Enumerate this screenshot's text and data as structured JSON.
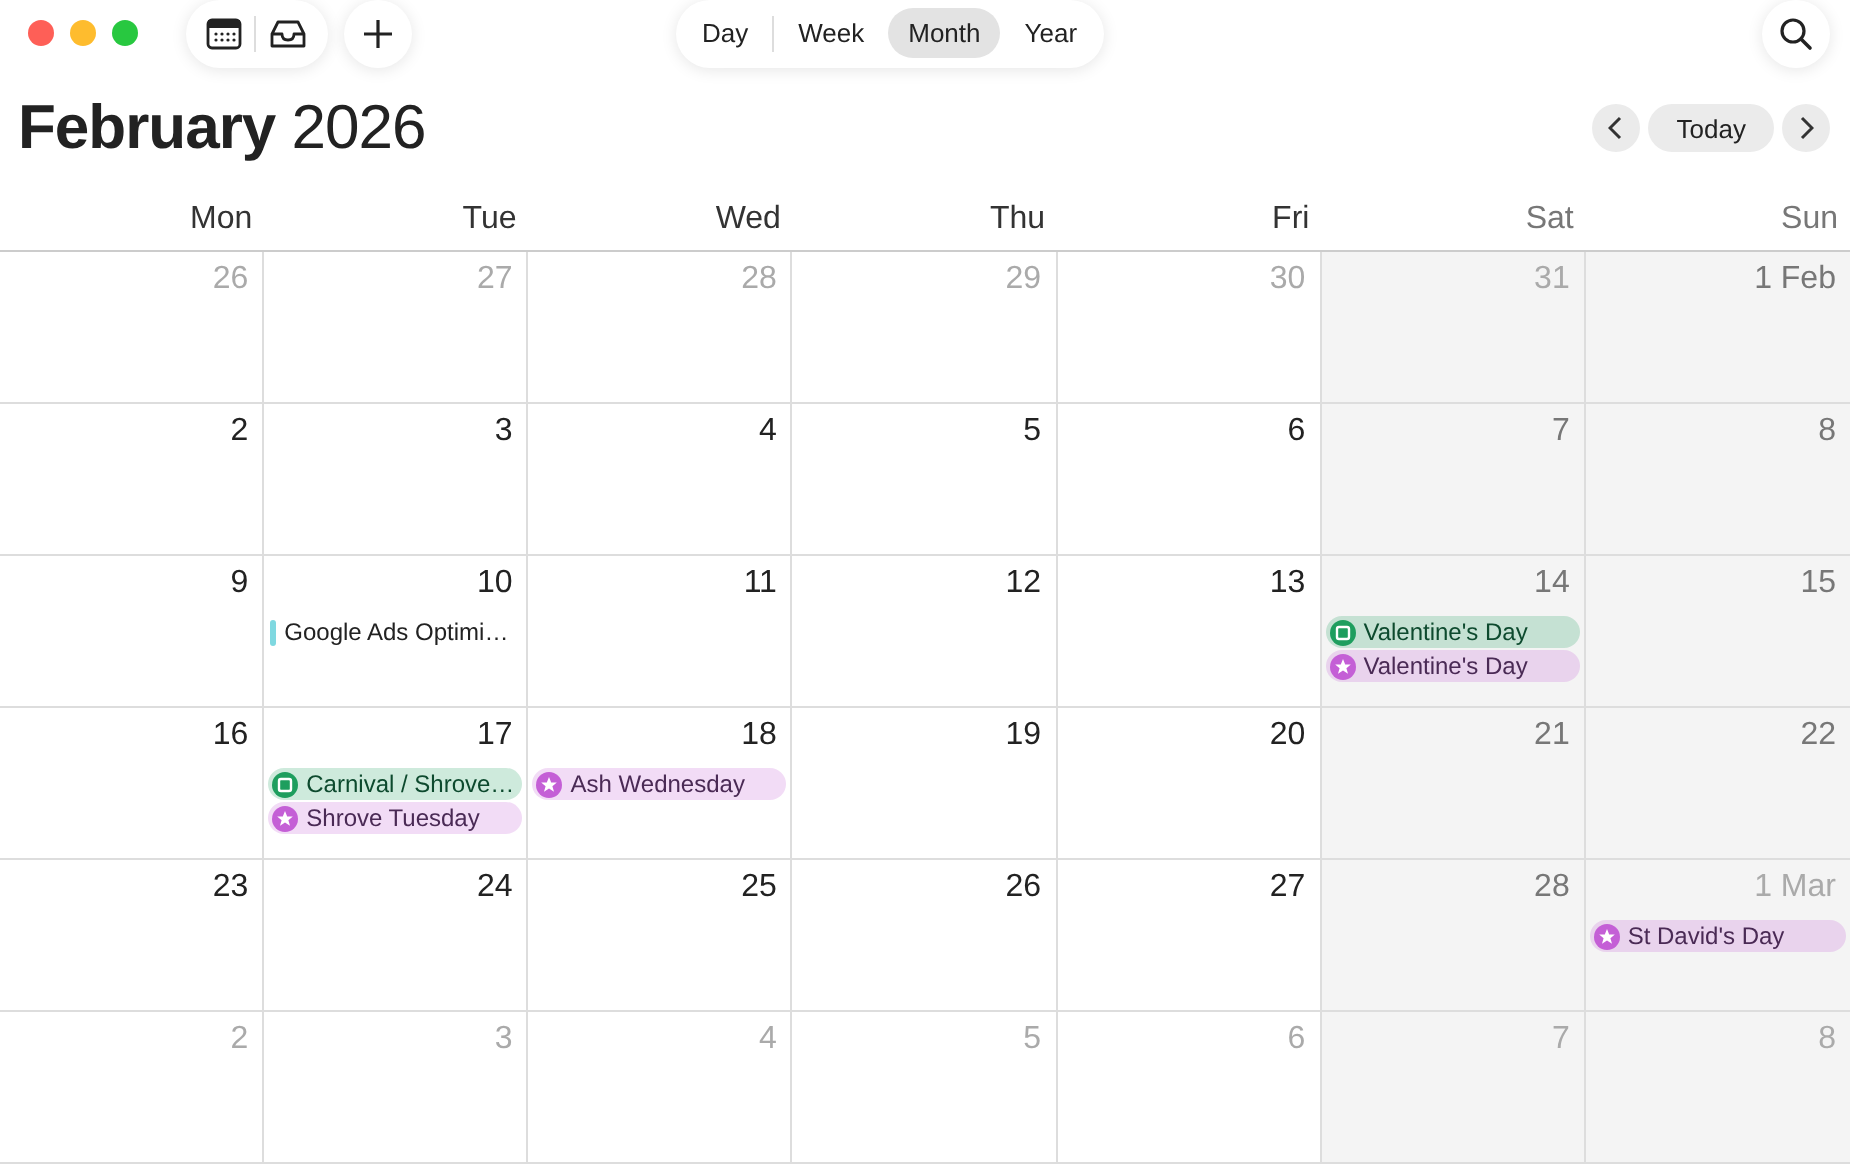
{
  "views": [
    {
      "label": "Day",
      "selected": false
    },
    {
      "label": "Week",
      "selected": false
    },
    {
      "label": "Month",
      "selected": true
    },
    {
      "label": "Year",
      "selected": false
    }
  ],
  "title": {
    "month": "February",
    "year": "2026"
  },
  "today_button": "Today",
  "weekdays": [
    {
      "label": "Mon",
      "weekend": false
    },
    {
      "label": "Tue",
      "weekend": false
    },
    {
      "label": "Wed",
      "weekend": false
    },
    {
      "label": "Thu",
      "weekend": false
    },
    {
      "label": "Fri",
      "weekend": false
    },
    {
      "label": "Sat",
      "weekend": true
    },
    {
      "label": "Sun",
      "weekend": true
    }
  ],
  "weeks": [
    [
      {
        "label": "26",
        "outside": true
      },
      {
        "label": "27",
        "outside": true
      },
      {
        "label": "28",
        "outside": true
      },
      {
        "label": "29",
        "outside": true
      },
      {
        "label": "30",
        "outside": true
      },
      {
        "label": "31",
        "outside": true
      },
      {
        "label": "1 Feb",
        "outside": false
      }
    ],
    [
      {
        "label": "2",
        "outside": false
      },
      {
        "label": "3",
        "outside": false
      },
      {
        "label": "4",
        "outside": false
      },
      {
        "label": "5",
        "outside": false
      },
      {
        "label": "6",
        "outside": false
      },
      {
        "label": "7",
        "outside": false
      },
      {
        "label": "8",
        "outside": false
      }
    ],
    [
      {
        "label": "9",
        "outside": false
      },
      {
        "label": "10",
        "outside": false,
        "events": [
          {
            "kind": "bar",
            "title": "Google Ads Optimi…",
            "color": "#7fd8e0"
          }
        ]
      },
      {
        "label": "11",
        "outside": false
      },
      {
        "label": "12",
        "outside": false
      },
      {
        "label": "13",
        "outside": false
      },
      {
        "label": "14",
        "outside": false,
        "events": [
          {
            "kind": "calendar",
            "title": "Valentine's Day",
            "color": "#1e9e5e"
          },
          {
            "kind": "star",
            "title": "Valentine's Day",
            "color": "#c45fd6"
          }
        ]
      },
      {
        "label": "15",
        "outside": false
      }
    ],
    [
      {
        "label": "16",
        "outside": false
      },
      {
        "label": "17",
        "outside": false,
        "events": [
          {
            "kind": "calendar",
            "title": "Carnival / Shrove…",
            "color": "#1e9e5e"
          },
          {
            "kind": "star",
            "title": "Shrove Tuesday",
            "color": "#c45fd6"
          }
        ]
      },
      {
        "label": "18",
        "outside": false,
        "events": [
          {
            "kind": "star",
            "title": "Ash Wednesday",
            "color": "#c45fd6"
          }
        ]
      },
      {
        "label": "19",
        "outside": false
      },
      {
        "label": "20",
        "outside": false
      },
      {
        "label": "21",
        "outside": false
      },
      {
        "label": "22",
        "outside": false
      }
    ],
    [
      {
        "label": "23",
        "outside": false
      },
      {
        "label": "24",
        "outside": false
      },
      {
        "label": "25",
        "outside": false
      },
      {
        "label": "26",
        "outside": false
      },
      {
        "label": "27",
        "outside": false
      },
      {
        "label": "28",
        "outside": false
      },
      {
        "label": "1 Mar",
        "outside": true,
        "events": [
          {
            "kind": "star",
            "title": "St David's Day",
            "color": "#c45fd6"
          }
        ]
      }
    ],
    [
      {
        "label": "2",
        "outside": true
      },
      {
        "label": "3",
        "outside": true
      },
      {
        "label": "4",
        "outside": true
      },
      {
        "label": "5",
        "outside": true
      },
      {
        "label": "6",
        "outside": true
      },
      {
        "label": "7",
        "outside": true
      },
      {
        "label": "8",
        "outside": true
      }
    ]
  ]
}
